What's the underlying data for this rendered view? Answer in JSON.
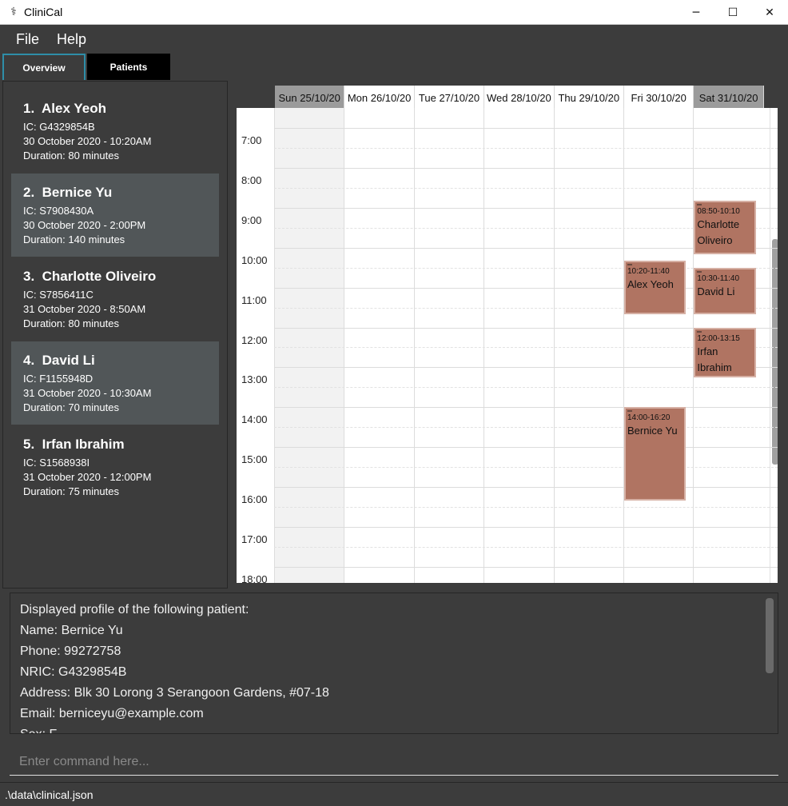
{
  "window": {
    "title": "CliniCal",
    "icon": "stethoscope-icon",
    "controls": [
      "─",
      "☐",
      "✕"
    ]
  },
  "menu": {
    "items": [
      "File",
      "Help"
    ]
  },
  "tabs": [
    {
      "label": "Overview",
      "active": true
    },
    {
      "label": "Patients",
      "active": false
    }
  ],
  "appointments_list": [
    {
      "index": "1.",
      "name": "Alex Yeoh",
      "ic": "IC: G4329854B",
      "datetime": "30 October 2020 - 10:20AM",
      "duration": "Duration: 80 minutes"
    },
    {
      "index": "2.",
      "name": "Bernice Yu",
      "ic": "IC: S7908430A",
      "datetime": "30 October 2020 - 2:00PM",
      "duration": "Duration: 140 minutes"
    },
    {
      "index": "3.",
      "name": "Charlotte Oliveiro",
      "ic": "IC: S7856411C",
      "datetime": "31 October 2020 - 8:50AM",
      "duration": "Duration: 80 minutes"
    },
    {
      "index": "4.",
      "name": "David Li",
      "ic": "IC: F1155948D",
      "datetime": "31 October 2020 - 10:30AM",
      "duration": "Duration: 70 minutes"
    },
    {
      "index": "5.",
      "name": "Irfan Ibrahim",
      "ic": "IC: S1568938I",
      "datetime": "31 October 2020 - 12:00PM",
      "duration": "Duration: 75 minutes"
    }
  ],
  "calendar": {
    "days": [
      "Sun 25/10/20",
      "Mon 26/10/20",
      "Tue 27/10/20",
      "Wed 28/10/20",
      "Thu 29/10/20",
      "Fri 30/10/20",
      "Sat 31/10/20"
    ],
    "hours": [
      "7:00",
      "8:00",
      "9:00",
      "10:00",
      "11:00",
      "12:00",
      "13:00",
      "14:00",
      "15:00",
      "16:00",
      "17:00",
      "18:00"
    ],
    "events": [
      {
        "day": 5,
        "time": "10:20-11:40",
        "name": "Alex Yeoh",
        "start": 10.333,
        "end": 11.667
      },
      {
        "day": 5,
        "time": "14:00-16:20",
        "name": "Bernice Yu",
        "start": 14.0,
        "end": 16.333
      },
      {
        "day": 6,
        "time": "08:50-10:10",
        "name": "Charlotte Oliveiro",
        "start": 8.833,
        "end": 10.167
      },
      {
        "day": 6,
        "time": "10:30-11:40",
        "name": "David Li",
        "start": 10.5,
        "end": 11.667
      },
      {
        "day": 6,
        "time": "12:00-13:15",
        "name": "Irfan Ibrahim",
        "start": 12.0,
        "end": 13.25
      }
    ]
  },
  "result": {
    "lines": [
      "Displayed profile of the following patient:",
      "Name: Bernice Yu",
      "Phone: 99272758",
      "NRIC: G4329854B",
      "Address: Blk 30 Lorong 3 Serangoon Gardens, #07-18",
      "Email: berniceyu@example.com",
      "Sex: F"
    ]
  },
  "command": {
    "placeholder": "Enter command here..."
  },
  "status": {
    "path": ".\\data\\clinical.json"
  }
}
